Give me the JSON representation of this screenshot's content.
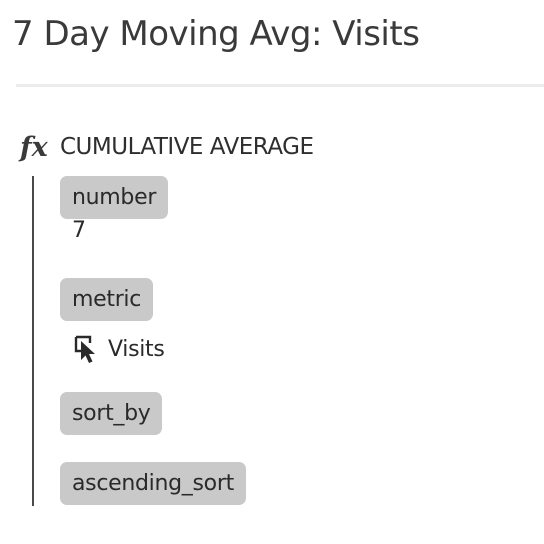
{
  "header": {
    "title": "7 Day Moving Avg: Visits"
  },
  "function": {
    "icon": "fx-icon",
    "icon_text": "fx",
    "name": "CUMULATIVE AVERAGE"
  },
  "params": {
    "number": {
      "label": "number",
      "value": "7"
    },
    "metric": {
      "label": "metric",
      "value": "Visits",
      "icon": "metric-cursor-icon"
    },
    "sort_by": {
      "label": "sort_by"
    },
    "ascending_sort": {
      "label": "ascending_sort"
    }
  }
}
